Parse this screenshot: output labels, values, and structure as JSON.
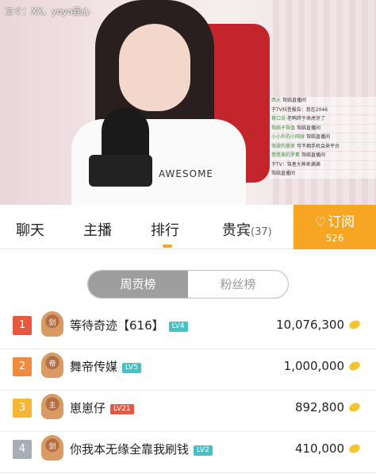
{
  "video": {
    "room_title": "ヱぐ：XX、yoyo我心",
    "shirt_text": "AWESOME",
    "chat": [
      {
        "user": "西元",
        "msg": "驾临直播间"
      },
      {
        "user": "",
        "msg": "于TV抖音报告：我在2046"
      },
      {
        "user": "脊口说",
        "msg": "老鸭终于来虎牙了"
      },
      {
        "user": "驾临于驾值",
        "msg": "驾临直播间"
      },
      {
        "user": "小小外的小网球",
        "msg": "驾临直播间"
      },
      {
        "user": "驾驶的豪荣",
        "msg": "可不拥手机会来平台"
      },
      {
        "user": "悠悠美的罗素",
        "msg": "驾临直播间"
      },
      {
        "user": "",
        "msg": "于TV：驾者大神来满满"
      },
      {
        "user": "",
        "msg": "驾临直播间"
      }
    ]
  },
  "tabs": [
    {
      "label": "聊天"
    },
    {
      "label": "主播"
    },
    {
      "label": "排行"
    },
    {
      "label": "贵宾",
      "count": "(37)"
    }
  ],
  "subscribe": {
    "label": "订阅",
    "icon": "heart-plus-icon",
    "count": "526"
  },
  "toggle": {
    "options": [
      "周贡榜",
      "粉丝榜"
    ],
    "selected": "周贡榜"
  },
  "colors": {
    "accent": "#f6a623",
    "rank1": "#e9573f",
    "rank2": "#f08a3c",
    "rank3": "#f5b535",
    "rank4": "#a8aeb5",
    "level": "#46c2c7",
    "level_red": "#e9573f"
  },
  "ranking": [
    {
      "rank": "1",
      "name": "等待奇迹【616】",
      "level": "LV4",
      "amount": "10,076,300",
      "badge": "剑"
    },
    {
      "rank": "2",
      "name": "舞帝传媒",
      "level": "LV5",
      "amount": "1,000,000",
      "badge": "帝"
    },
    {
      "rank": "3",
      "name": "崽崽仔",
      "level": "LV21",
      "amount": "892,800",
      "badge": "主"
    },
    {
      "rank": "4",
      "name": "你我本无缘全靠我刷钱",
      "level": "LV2",
      "amount": "410,000",
      "badge": "剑"
    }
  ]
}
